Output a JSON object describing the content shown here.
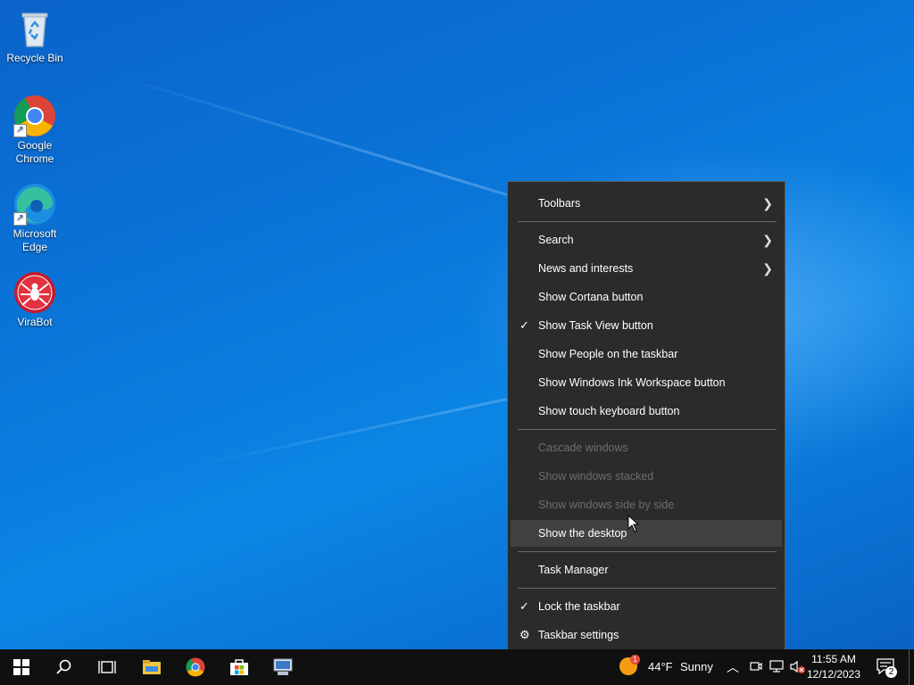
{
  "desktop": {
    "icons": [
      {
        "label": "Recycle Bin"
      },
      {
        "label": "Google Chrome"
      },
      {
        "label": "Microsoft Edge"
      },
      {
        "label": "ViraBot"
      }
    ]
  },
  "context_menu": {
    "items": [
      {
        "label": "Toolbars",
        "submenu": true
      },
      {
        "label": "Search",
        "submenu": true
      },
      {
        "label": "News and interests",
        "submenu": true
      },
      {
        "label": "Show Cortana button"
      },
      {
        "label": "Show Task View button",
        "checked": true
      },
      {
        "label": "Show People on the taskbar"
      },
      {
        "label": "Show Windows Ink Workspace button"
      },
      {
        "label": "Show touch keyboard button"
      },
      {
        "label": "Cascade windows",
        "disabled": true
      },
      {
        "label": "Show windows stacked",
        "disabled": true
      },
      {
        "label": "Show windows side by side",
        "disabled": true
      },
      {
        "label": "Show the desktop",
        "highlighted": true
      },
      {
        "label": "Task Manager"
      },
      {
        "label": "Lock the taskbar",
        "checked": true
      },
      {
        "label": "Taskbar settings",
        "icon": "gear-icon"
      }
    ]
  },
  "taskbar": {
    "weather_temp": "44°F",
    "weather_condition": "Sunny",
    "weather_badge": "1",
    "time": "11:55 AM",
    "date": "12/12/2023",
    "notification_count": "2"
  },
  "colors": {
    "menu_bg": "#2b2b2b",
    "menu_highlight": "#414141",
    "taskbar_bg": "#101010",
    "desktop_blue": "#0a78da"
  }
}
